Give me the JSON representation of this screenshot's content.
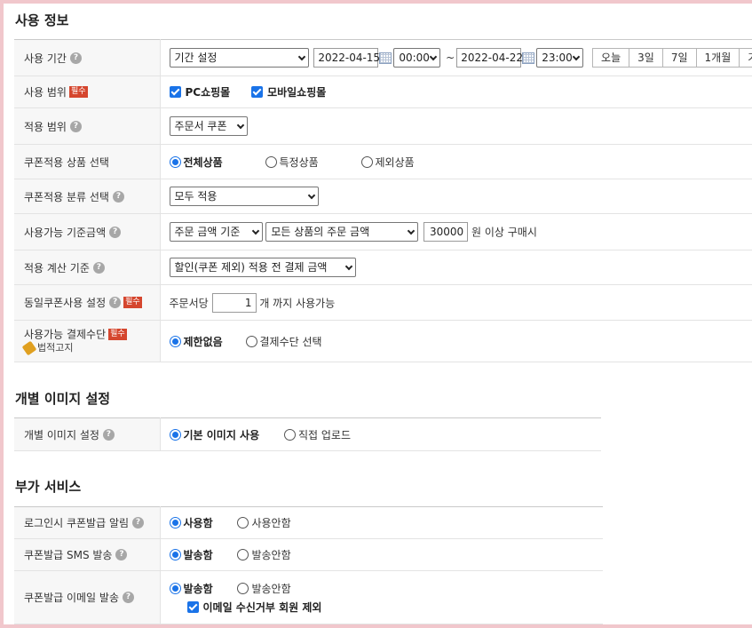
{
  "sections": {
    "usage": "사용 정보",
    "image": "개별 이미지 설정",
    "extra": "부가 서비스"
  },
  "usage": {
    "period": {
      "label": "사용 기간",
      "mode": "기간 설정",
      "start_date": "2022-04-15",
      "start_time": "00:00",
      "tilde": "~",
      "end_date": "2022-04-22",
      "end_time": "23:00",
      "quick": [
        "오늘",
        "3일",
        "7일",
        "1개월",
        "기본"
      ]
    },
    "scope": {
      "label": "사용 범위",
      "required": "필수",
      "options": [
        "PC쇼핑몰",
        "모바일쇼핑몰"
      ]
    },
    "apply": {
      "label": "적용 범위",
      "value": "주문서 쿠폰"
    },
    "product": {
      "label": "쿠폰적용 상품 선택",
      "options": [
        "전체상품",
        "특정상품",
        "제외상품"
      ]
    },
    "category": {
      "label": "쿠폰적용 분류 선택",
      "value": "모두 적용"
    },
    "base_amount": {
      "label": "사용가능 기준금액",
      "basis": "주문 금액 기준",
      "target": "모든 상품의 주문 금액",
      "amount": "30000",
      "suffix": "원 이상 구매시"
    },
    "calc": {
      "label": "적용 계산 기준",
      "value": "할인(쿠폰 제외) 적용 전 결제 금액"
    },
    "same": {
      "label": "동일쿠폰사용 설정",
      "required": "필수",
      "prefix": "주문서당",
      "count": "1",
      "suffix": "개 까지 사용가능"
    },
    "payment": {
      "label": "사용가능 결제수단",
      "required": "필수",
      "legal": "법적고지",
      "options": [
        "제한없음",
        "결제수단 선택"
      ]
    }
  },
  "image": {
    "label": "개별 이미지 설정",
    "options": [
      "기본 이미지 사용",
      "직접 업로드"
    ]
  },
  "extra": {
    "login_alert": {
      "label": "로그인시 쿠폰발급 알림",
      "options": [
        "사용함",
        "사용안함"
      ]
    },
    "sms": {
      "label": "쿠폰발급 SMS 발송",
      "options": [
        "발송함",
        "발송안함"
      ]
    },
    "email": {
      "label": "쿠폰발급 이메일 발송",
      "options": [
        "발송함",
        "발송안함"
      ],
      "exclude": "이메일 수신거부 회원 제외"
    }
  },
  "help_glyph": "?",
  "colors": {
    "accent": "#1a73e8",
    "required": "#d5462e",
    "frame": "#f1c7cc"
  }
}
